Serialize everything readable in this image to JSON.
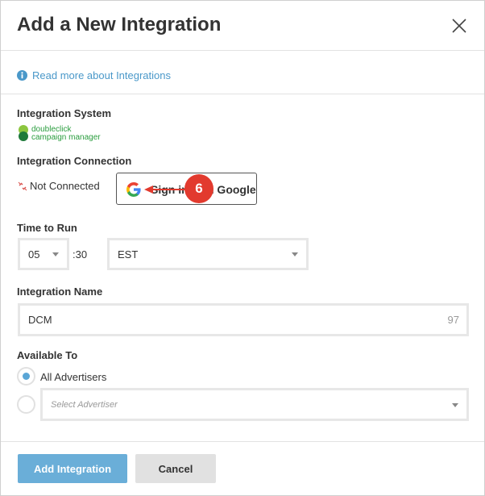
{
  "header": {
    "title": "Add a New Integration",
    "close_icon": "close-icon"
  },
  "info": {
    "icon": "info-circle-icon",
    "link_text": "Read more about Integrations"
  },
  "integration_system": {
    "label": "Integration System",
    "logo_line1": "doubleclick",
    "logo_line2": "campaign manager",
    "logo_color": "#2a9d3e"
  },
  "integration_connection": {
    "label": "Integration Connection",
    "status_icon": "broken-link-icon",
    "status_text": "Not Connected",
    "google_button_label": "Sign in with Google",
    "callout_number": "6",
    "callout_color": "#e23a2e"
  },
  "time_to_run": {
    "label": "Time to Run",
    "hour_value": "05",
    "minute_text": ":30",
    "timezone_value": "EST"
  },
  "integration_name": {
    "label": "Integration Name",
    "value": "DCM",
    "char_count": "97"
  },
  "available_to": {
    "label": "Available To",
    "all_advertisers_label": "All Advertisers",
    "all_advertisers_selected": true,
    "select_advertiser_placeholder": "Select Advertiser"
  },
  "footer": {
    "add_button": "Add Integration",
    "cancel_button": "Cancel"
  },
  "colors": {
    "primary_button": "#6aaed8",
    "link": "#4a98c9",
    "radio_selected": "#5aa6d6"
  }
}
